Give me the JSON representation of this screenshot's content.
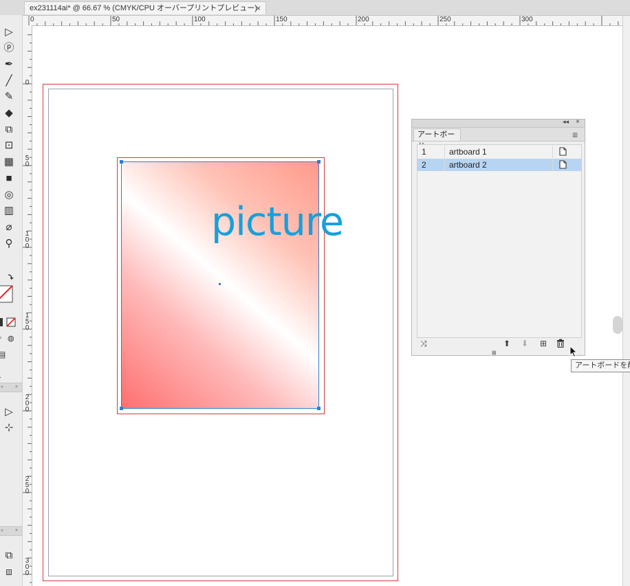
{
  "document_tab": {
    "title": "ex231114ai* @ 66.67 % (CMYK/CPU オーバープリントプレビュー)",
    "close_label": "×"
  },
  "ruler": {
    "top_labels": [
      "0",
      "50",
      "100",
      "150",
      "200",
      "250",
      "300"
    ],
    "left_labels": [
      "0",
      "5\n0",
      "1\n0\n0",
      "1\n5\n0",
      "2\n0\n0",
      "2\n5\n0",
      "3\n0\n0"
    ]
  },
  "toolbar": {
    "tools": [
      {
        "name": "selection-tool",
        "glyph": "▷"
      },
      {
        "name": "lasso-tool",
        "glyph": "ⓟ"
      },
      {
        "name": "pen-tool",
        "glyph": "✒"
      },
      {
        "name": "line-tool",
        "glyph": "╱"
      },
      {
        "name": "paintbrush-tool",
        "glyph": "✎"
      },
      {
        "name": "eraser-tool",
        "glyph": "◆"
      },
      {
        "name": "scale-tool",
        "glyph": "⧉"
      },
      {
        "name": "free-transform-tool",
        "glyph": "⊡"
      },
      {
        "name": "perspective-grid-tool",
        "glyph": "▦"
      },
      {
        "name": "gradient-tool",
        "glyph": "■"
      },
      {
        "name": "blend-tool",
        "glyph": "◎"
      },
      {
        "name": "graph-tool",
        "glyph": "▥"
      },
      {
        "name": "eyedropper-tool",
        "glyph": "⌀"
      },
      {
        "name": "zoom-tool",
        "glyph": "⚲"
      }
    ],
    "lower_tools": [
      {
        "name": "direct-selection-tool",
        "glyph": "▷"
      },
      {
        "name": "add-anchor-tool",
        "glyph": "⊹"
      }
    ],
    "bottom_tools": [
      {
        "name": "artboard-export-tool",
        "glyph": "⧉"
      },
      {
        "name": "place-tool",
        "glyph": "⧈"
      }
    ],
    "collapse_glyph": "»",
    "close_glyph": "×"
  },
  "canvas": {
    "picture_text": "picture",
    "gradient_colors": [
      "#ff6f6f",
      "#ffffff",
      "#ff9a8a"
    ],
    "artboard_outline_color": "#d43a3a",
    "selection_color": "#2d7fd6",
    "text_color": "#17a0db"
  },
  "artboards_panel": {
    "tab_label": "アートボード",
    "menu_icon": "≡",
    "collapse_icon": "◂◂",
    "close_icon": "×",
    "rows": [
      {
        "number": "1",
        "name": "artboard 1",
        "selected": false
      },
      {
        "number": "2",
        "name": "artboard 2",
        "selected": true
      }
    ],
    "buttons": {
      "rearrange": "⤨",
      "move_up": "⬆",
      "move_down": "⬇",
      "new_artboard": "⊞",
      "delete_artboard": "🗑"
    }
  },
  "tooltip": {
    "text": "アートボードを削除"
  }
}
